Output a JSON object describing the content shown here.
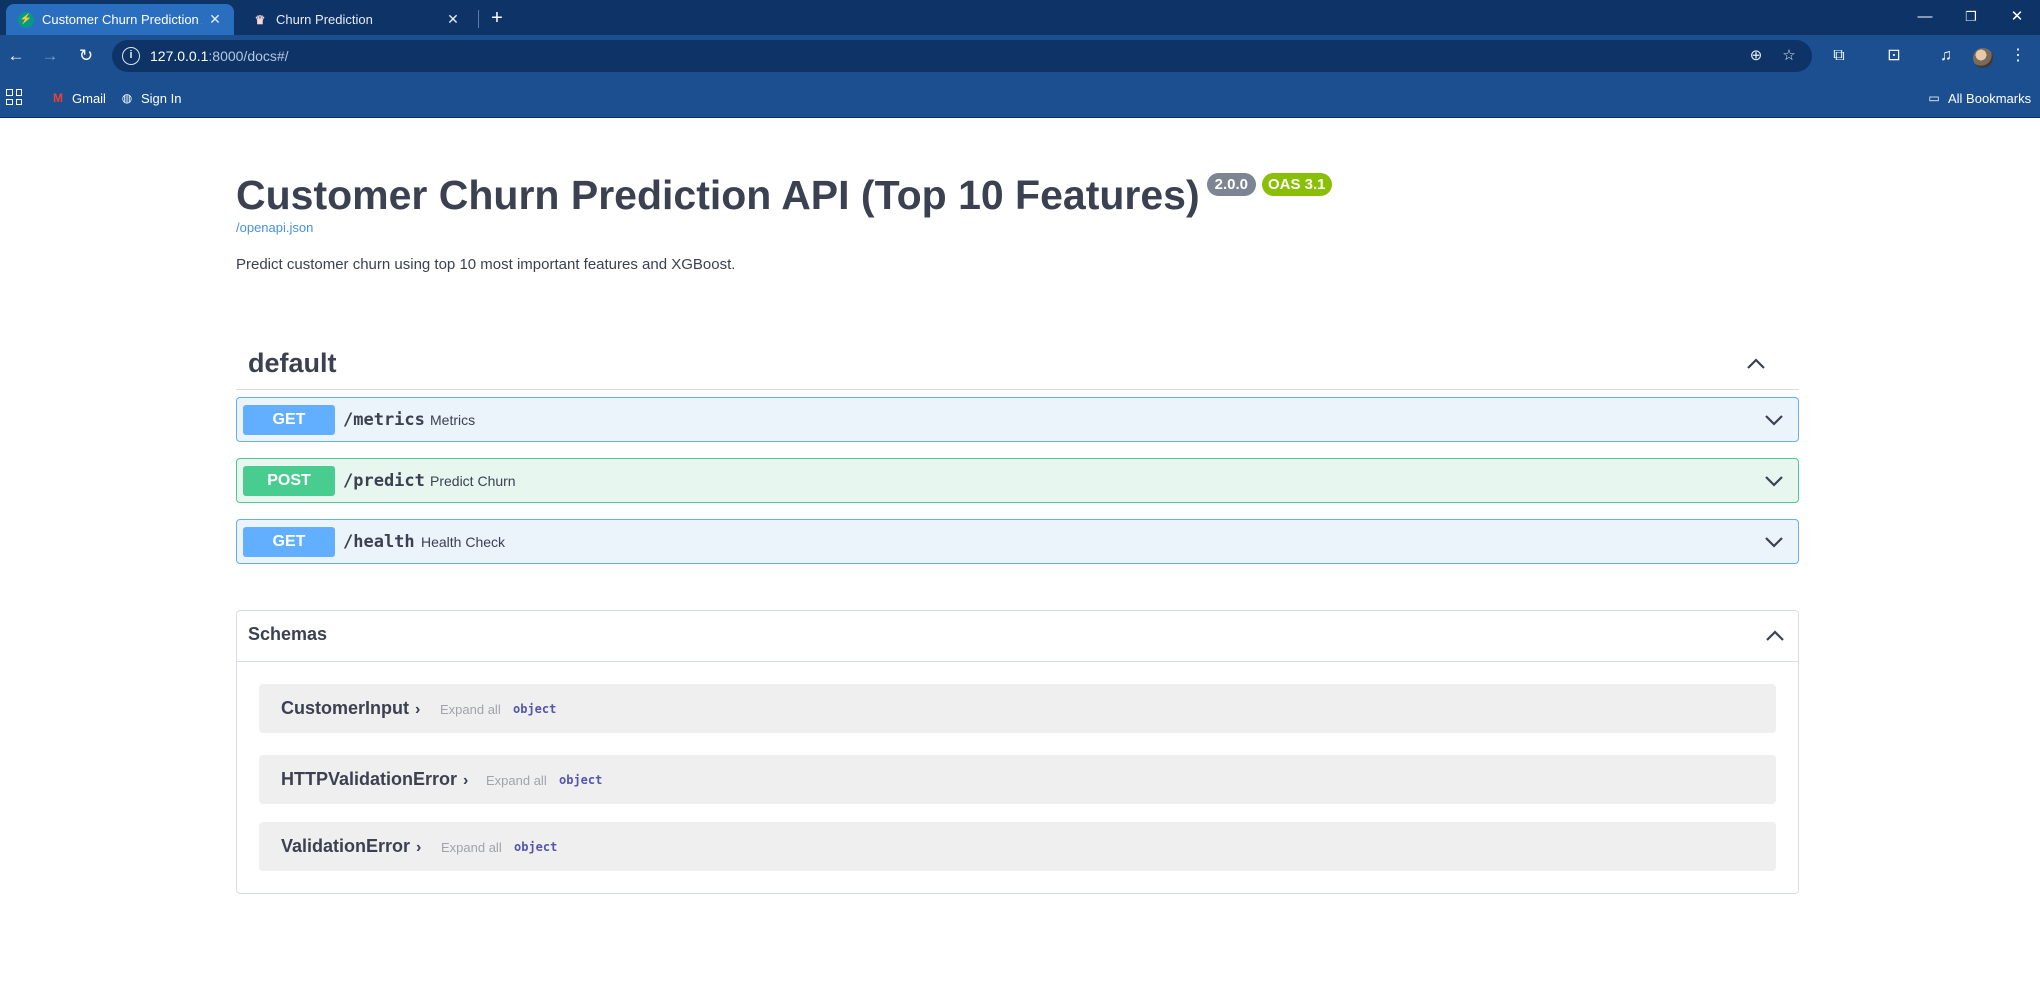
{
  "browser": {
    "tabs": [
      {
        "title": "Customer Churn Prediction API",
        "active": true,
        "favicon": "fastapi-icon"
      },
      {
        "title": "Churn Prediction",
        "active": false,
        "favicon": "crown-icon"
      }
    ],
    "url_host": "127.0.0.1",
    "url_rest": ":8000/docs#/",
    "bookmarks": [
      {
        "label": "Gmail",
        "icon": "gmail-icon"
      },
      {
        "label": "Sign In",
        "icon": "globe-icon"
      }
    ],
    "all_bookmarks": "All Bookmarks"
  },
  "api": {
    "title": "Customer Churn Prediction API (Top 10 Features)",
    "version": "2.0.0",
    "oas": "OAS 3.1",
    "openapi_link": "/openapi.json",
    "description": "Predict customer churn using top 10 most important features and XGBoost."
  },
  "tag": {
    "name": "default",
    "operations": [
      {
        "method": "GET",
        "path": "/metrics",
        "summary": "Metrics"
      },
      {
        "method": "POST",
        "path": "/predict",
        "summary": "Predict Churn"
      },
      {
        "method": "GET",
        "path": "/health",
        "summary": "Health Check"
      }
    ]
  },
  "schemas": {
    "title": "Schemas",
    "models": [
      {
        "name": "CustomerInput",
        "expand": "Expand all",
        "type": "object"
      },
      {
        "name": "HTTPValidationError",
        "expand": "Expand all",
        "type": "object"
      },
      {
        "name": "ValidationError",
        "expand": "Expand all",
        "type": "object"
      }
    ]
  },
  "colors": {
    "get": "#61affe",
    "post": "#49cc90",
    "version_badge": "#7d8492",
    "oas_badge": "#89bf04",
    "link": "#4990e2",
    "chrome": "#1b4f90"
  }
}
